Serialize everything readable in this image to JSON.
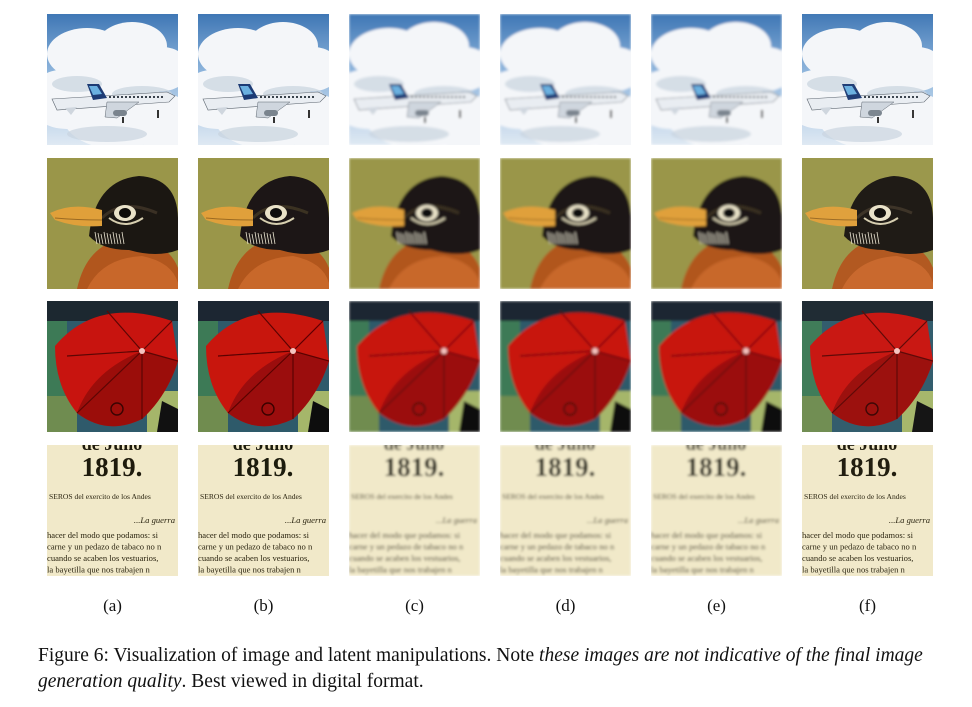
{
  "figure": {
    "columns": [
      {
        "label": "(a)",
        "variant": "original"
      },
      {
        "label": "(b)",
        "variant": "noise"
      },
      {
        "label": "(c)",
        "variant": "blur"
      },
      {
        "label": "(d)",
        "variant": "blur"
      },
      {
        "label": "(e)",
        "variant": "blur"
      },
      {
        "label": "(f)",
        "variant": "sharp"
      }
    ],
    "rows": [
      {
        "subject": "airplane"
      },
      {
        "subject": "bird"
      },
      {
        "subject": "umbrella"
      },
      {
        "subject": "document",
        "text": {
          "header": "de Julio",
          "year": "1819.",
          "line1": "SEROS del exercito de los Andes",
          "line2": "...La guerra",
          "body": [
            "hacer del modo que podamos: si",
            "carne y un pedazo de tabaco no n",
            "cuando se acaben los vestuarios,",
            "la bayetilla que nos trabajen n"
          ]
        }
      }
    ]
  },
  "caption": {
    "prefix": "Figure 6: Visualization of image and latent manipulations. Note ",
    "emphasis": "these images are not indicative of the final image generation quality",
    "suffix": ". Best viewed in digital format."
  }
}
